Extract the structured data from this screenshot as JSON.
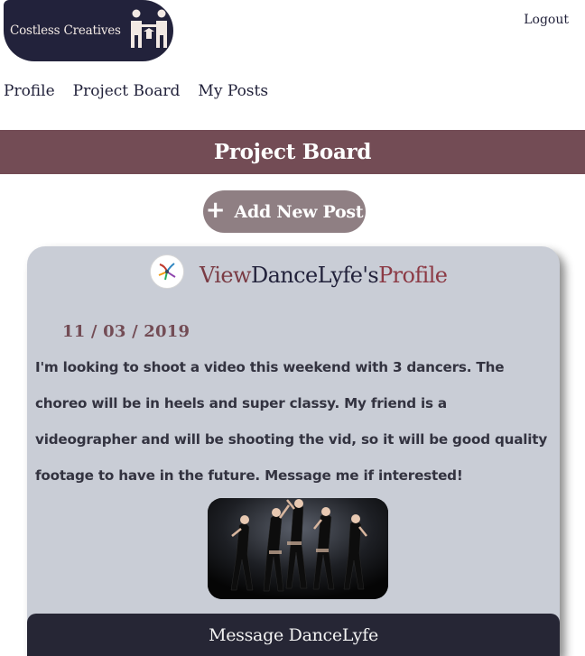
{
  "header": {
    "logo_text": "Costless Creatives",
    "logout_label": "Logout"
  },
  "nav": {
    "items": [
      {
        "label": "Profile"
      },
      {
        "label": "Project Board"
      },
      {
        "label": "My Posts"
      }
    ]
  },
  "banner": {
    "title": "Project Board"
  },
  "add_post": {
    "label": "Add New Post",
    "icon": "plus-icon"
  },
  "post": {
    "profile_link": {
      "view": "View",
      "username": "DanceLyfe's",
      "profile": "Profile"
    },
    "date": "11 / 03 / 2019",
    "body": "I'm looking to shoot a video this weekend with 3 dancers. The choreo will be in heels and super classy. My friend is a videographer and will be shooting the vid, so it will be good quality footage to have in the future. Message me if interested!",
    "message_label": "Message DanceLyfe"
  },
  "colors": {
    "navy": "#22223b",
    "banner": "#734c55",
    "add_button": "#8f7f83",
    "card": "#c9cdd6",
    "accent": "#8c3a45"
  }
}
